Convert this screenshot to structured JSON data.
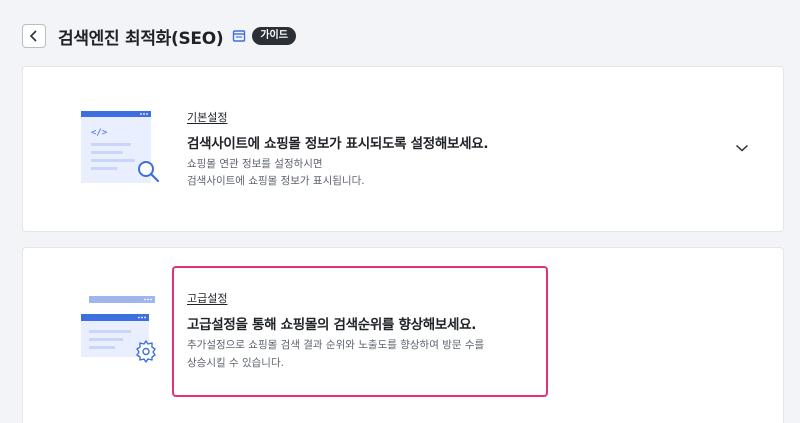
{
  "header": {
    "title": "검색엔진 최적화(SEO)",
    "guide_badge": "가이드",
    "back_icon": "chevron-left-icon",
    "book_icon": "book-icon"
  },
  "sections": [
    {
      "label": "기본설정",
      "headline": "검색사이트에 쇼핑몰 정보가 표시되도록 설정해보세요.",
      "desc_lines": [
        "쇼핑몰 연관 정보를 설정하시면",
        "검색사이트에 쇼핑몰 정보가 표시됩니다."
      ],
      "illustration_icon": "code-search-icon",
      "expand_icon": "chevron-down-icon"
    },
    {
      "label": "고급설정",
      "headline": "고급설정을 통해 쇼핑몰의 검색순위를 향상해보세요.",
      "desc_lines": [
        "추가설정으로 쇼핑몰 검색 결과 순위와 노출도를 향상하여 방문 수를",
        "상승시킬 수 있습니다."
      ],
      "illustration_icon": "settings-gear-icon"
    }
  ],
  "colors": {
    "accent_blue": "#3d6fe0",
    "highlight": "#e2317a",
    "badge_bg": "#2b2f36"
  }
}
